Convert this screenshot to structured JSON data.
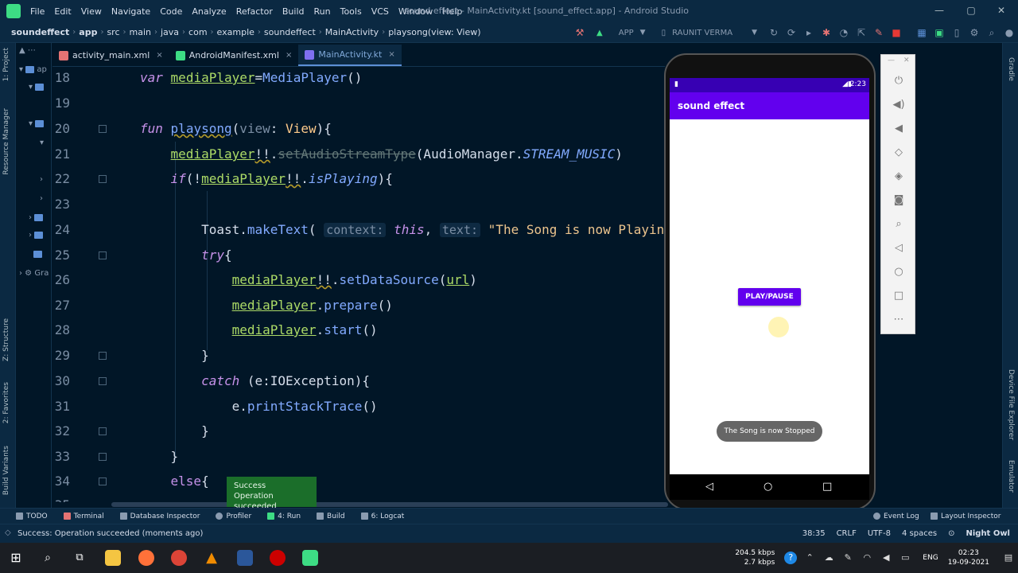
{
  "window": {
    "title": "sound effect - MainActivity.kt [sound_effect.app] - Android Studio",
    "controls": [
      "—",
      "▢",
      "✕"
    ]
  },
  "menu": [
    "File",
    "Edit",
    "View",
    "Navigate",
    "Code",
    "Analyze",
    "Refactor",
    "Build",
    "Run",
    "Tools",
    "VCS",
    "Window",
    "Help"
  ],
  "breadcrumbs": [
    "soundeffect",
    "app",
    "src",
    "main",
    "java",
    "com",
    "example",
    "soundeffect",
    "MainActivity",
    "playsong(view: View)"
  ],
  "toolbar": {
    "run_config": "APP",
    "device": "RAUNIT VERMA"
  },
  "tabs": [
    {
      "label": "activity_main.xml",
      "close": "×",
      "color": "#e57373"
    },
    {
      "label": "AndroidManifest.xml",
      "close": "×",
      "color": "#3ddc84"
    },
    {
      "label": "MainActivity.kt",
      "close": "×",
      "color": "#7f6ff0",
      "active": true
    }
  ],
  "left_stripe": [
    "1: Project",
    "Resource Manager",
    "Z: Structure",
    "2: Favorites",
    "Build Variants"
  ],
  "project_panel": [
    "ap",
    "Gra"
  ],
  "right_stripe": [
    "Gradle",
    "Device File Explorer",
    "Emulator"
  ],
  "editor": {
    "line_numbers": [
      "18",
      "19",
      "20",
      "21",
      "22",
      "23",
      "24",
      "25",
      "26",
      "27",
      "28",
      "29",
      "30",
      "31",
      "32",
      "33",
      "34",
      "35"
    ],
    "hint_context": "context:",
    "hint_text": "text:",
    "toast_string": "\"The Song is now Playing\""
  },
  "emulator": {
    "time": "2:23",
    "app_title": "sound effect",
    "button_label": "PLAY/PAUSE",
    "toast": "The Song is now Stopped",
    "top_controls": [
      "—",
      "✕"
    ],
    "tools": [
      "power-icon",
      "volume-up-icon",
      "volume-down-icon",
      "rotate-left-icon",
      "rotate-right-icon",
      "camera-icon",
      "zoom-icon",
      "back-icon",
      "home-icon",
      "overview-icon",
      "more-icon"
    ]
  },
  "balloon": {
    "title": "Success",
    "message": "Operation succeeded"
  },
  "toolwindows": [
    "TODO",
    "Terminal",
    "Database Inspector",
    "Profiler",
    "4: Run",
    "Build",
    "6: Logcat"
  ],
  "toolwindows_right": [
    "Event Log",
    "Layout Inspector"
  ],
  "status": {
    "message": "Success: Operation succeeded (moments ago)",
    "position": "38:35",
    "line_sep": "CRLF",
    "encoding": "UTF-8",
    "indent": "4 spaces",
    "theme": "Night Owl"
  },
  "taskbar": {
    "speed_up": "204.5 kbps",
    "speed_down": "2.7 kbps",
    "lang": "ENG",
    "time": "02:23",
    "date": "19-09-2021"
  },
  "colors": {
    "editor_bg": "#011627",
    "app_bar": "#6200ee",
    "balloon": "#1b6e2a"
  }
}
